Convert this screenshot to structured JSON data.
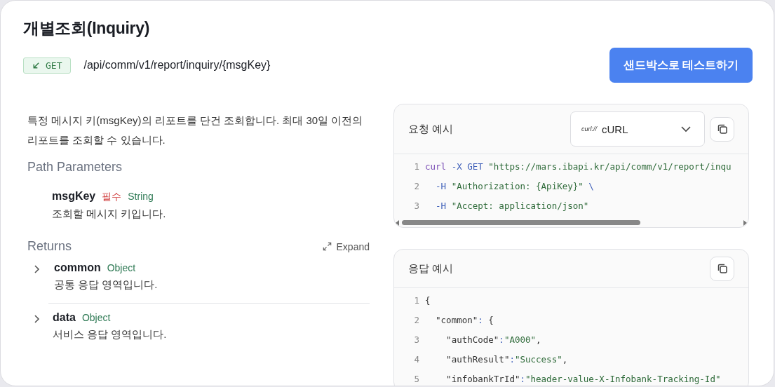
{
  "title": "개별조회(Inquiry)",
  "endpoint": {
    "method": "GET",
    "path": "/api/comm/v1/report/inquiry/{msgKey}"
  },
  "sandbox_button": "샌드박스로 테스트하기",
  "description": "특정 메시지 키(msgKey)의 리포트를 단건 조회합니다. 최대 30일 이전의 리포트를 조회할 수 있습니다.",
  "path_parameters": {
    "heading": "Path Parameters",
    "items": [
      {
        "name": "msgKey",
        "required": "필수",
        "type": "String",
        "description": "조회할 메시지 키입니다."
      }
    ]
  },
  "returns": {
    "heading": "Returns",
    "expand": "Expand",
    "items": [
      {
        "name": "common",
        "type": "Object",
        "description": "공통 응답 영역입니다.",
        "expanded": false
      },
      {
        "name": "data",
        "type": "Object",
        "description": "서비스 응답 영역입니다.",
        "expanded": false
      }
    ]
  },
  "request_example": {
    "title": "요청 예시",
    "language": {
      "logo": "curl://",
      "label": "cURL"
    },
    "lines": [
      {
        "number": "1",
        "tokens": [
          {
            "text": "curl",
            "kind": "keyword"
          },
          {
            "text": " -X GET ",
            "kind": "flag"
          },
          {
            "text": "\"https://mars.ibapi.kr/api/comm/v1/report/inqu",
            "kind": "string"
          }
        ]
      },
      {
        "number": "2",
        "tokens": [
          {
            "text": "  -H ",
            "kind": "flag"
          },
          {
            "text": "\"Authorization: {ApiKey}\"",
            "kind": "string"
          },
          {
            "text": " \\",
            "kind": "flag"
          }
        ]
      },
      {
        "number": "3",
        "tokens": [
          {
            "text": "  -H ",
            "kind": "flag"
          },
          {
            "text": "\"Accept: application/json\"",
            "kind": "string"
          }
        ]
      }
    ]
  },
  "response_example": {
    "title": "응답 예시",
    "lines": [
      {
        "number": "1",
        "tokens": [
          {
            "text": "{",
            "kind": "plain"
          }
        ]
      },
      {
        "number": "2",
        "tokens": [
          {
            "text": "  \"common\"",
            "kind": "plain"
          },
          {
            "text": ": ",
            "kind": "flag"
          },
          {
            "text": "{",
            "kind": "plain"
          }
        ]
      },
      {
        "number": "3",
        "tokens": [
          {
            "text": "    \"authCode\"",
            "kind": "plain"
          },
          {
            "text": ":",
            "kind": "flag"
          },
          {
            "text": "\"A000\"",
            "kind": "string"
          },
          {
            "text": ",",
            "kind": "plain"
          }
        ]
      },
      {
        "number": "4",
        "tokens": [
          {
            "text": "    \"authResult\"",
            "kind": "plain"
          },
          {
            "text": ":",
            "kind": "flag"
          },
          {
            "text": "\"Success\"",
            "kind": "string"
          },
          {
            "text": ",",
            "kind": "plain"
          }
        ]
      },
      {
        "number": "5",
        "tokens": [
          {
            "text": "    \"infobankTrId\"",
            "kind": "plain"
          },
          {
            "text": ":",
            "kind": "flag"
          },
          {
            "text": "\"header-value-X-Infobank-Tracking-Id\"",
            "kind": "string"
          }
        ]
      }
    ]
  }
}
